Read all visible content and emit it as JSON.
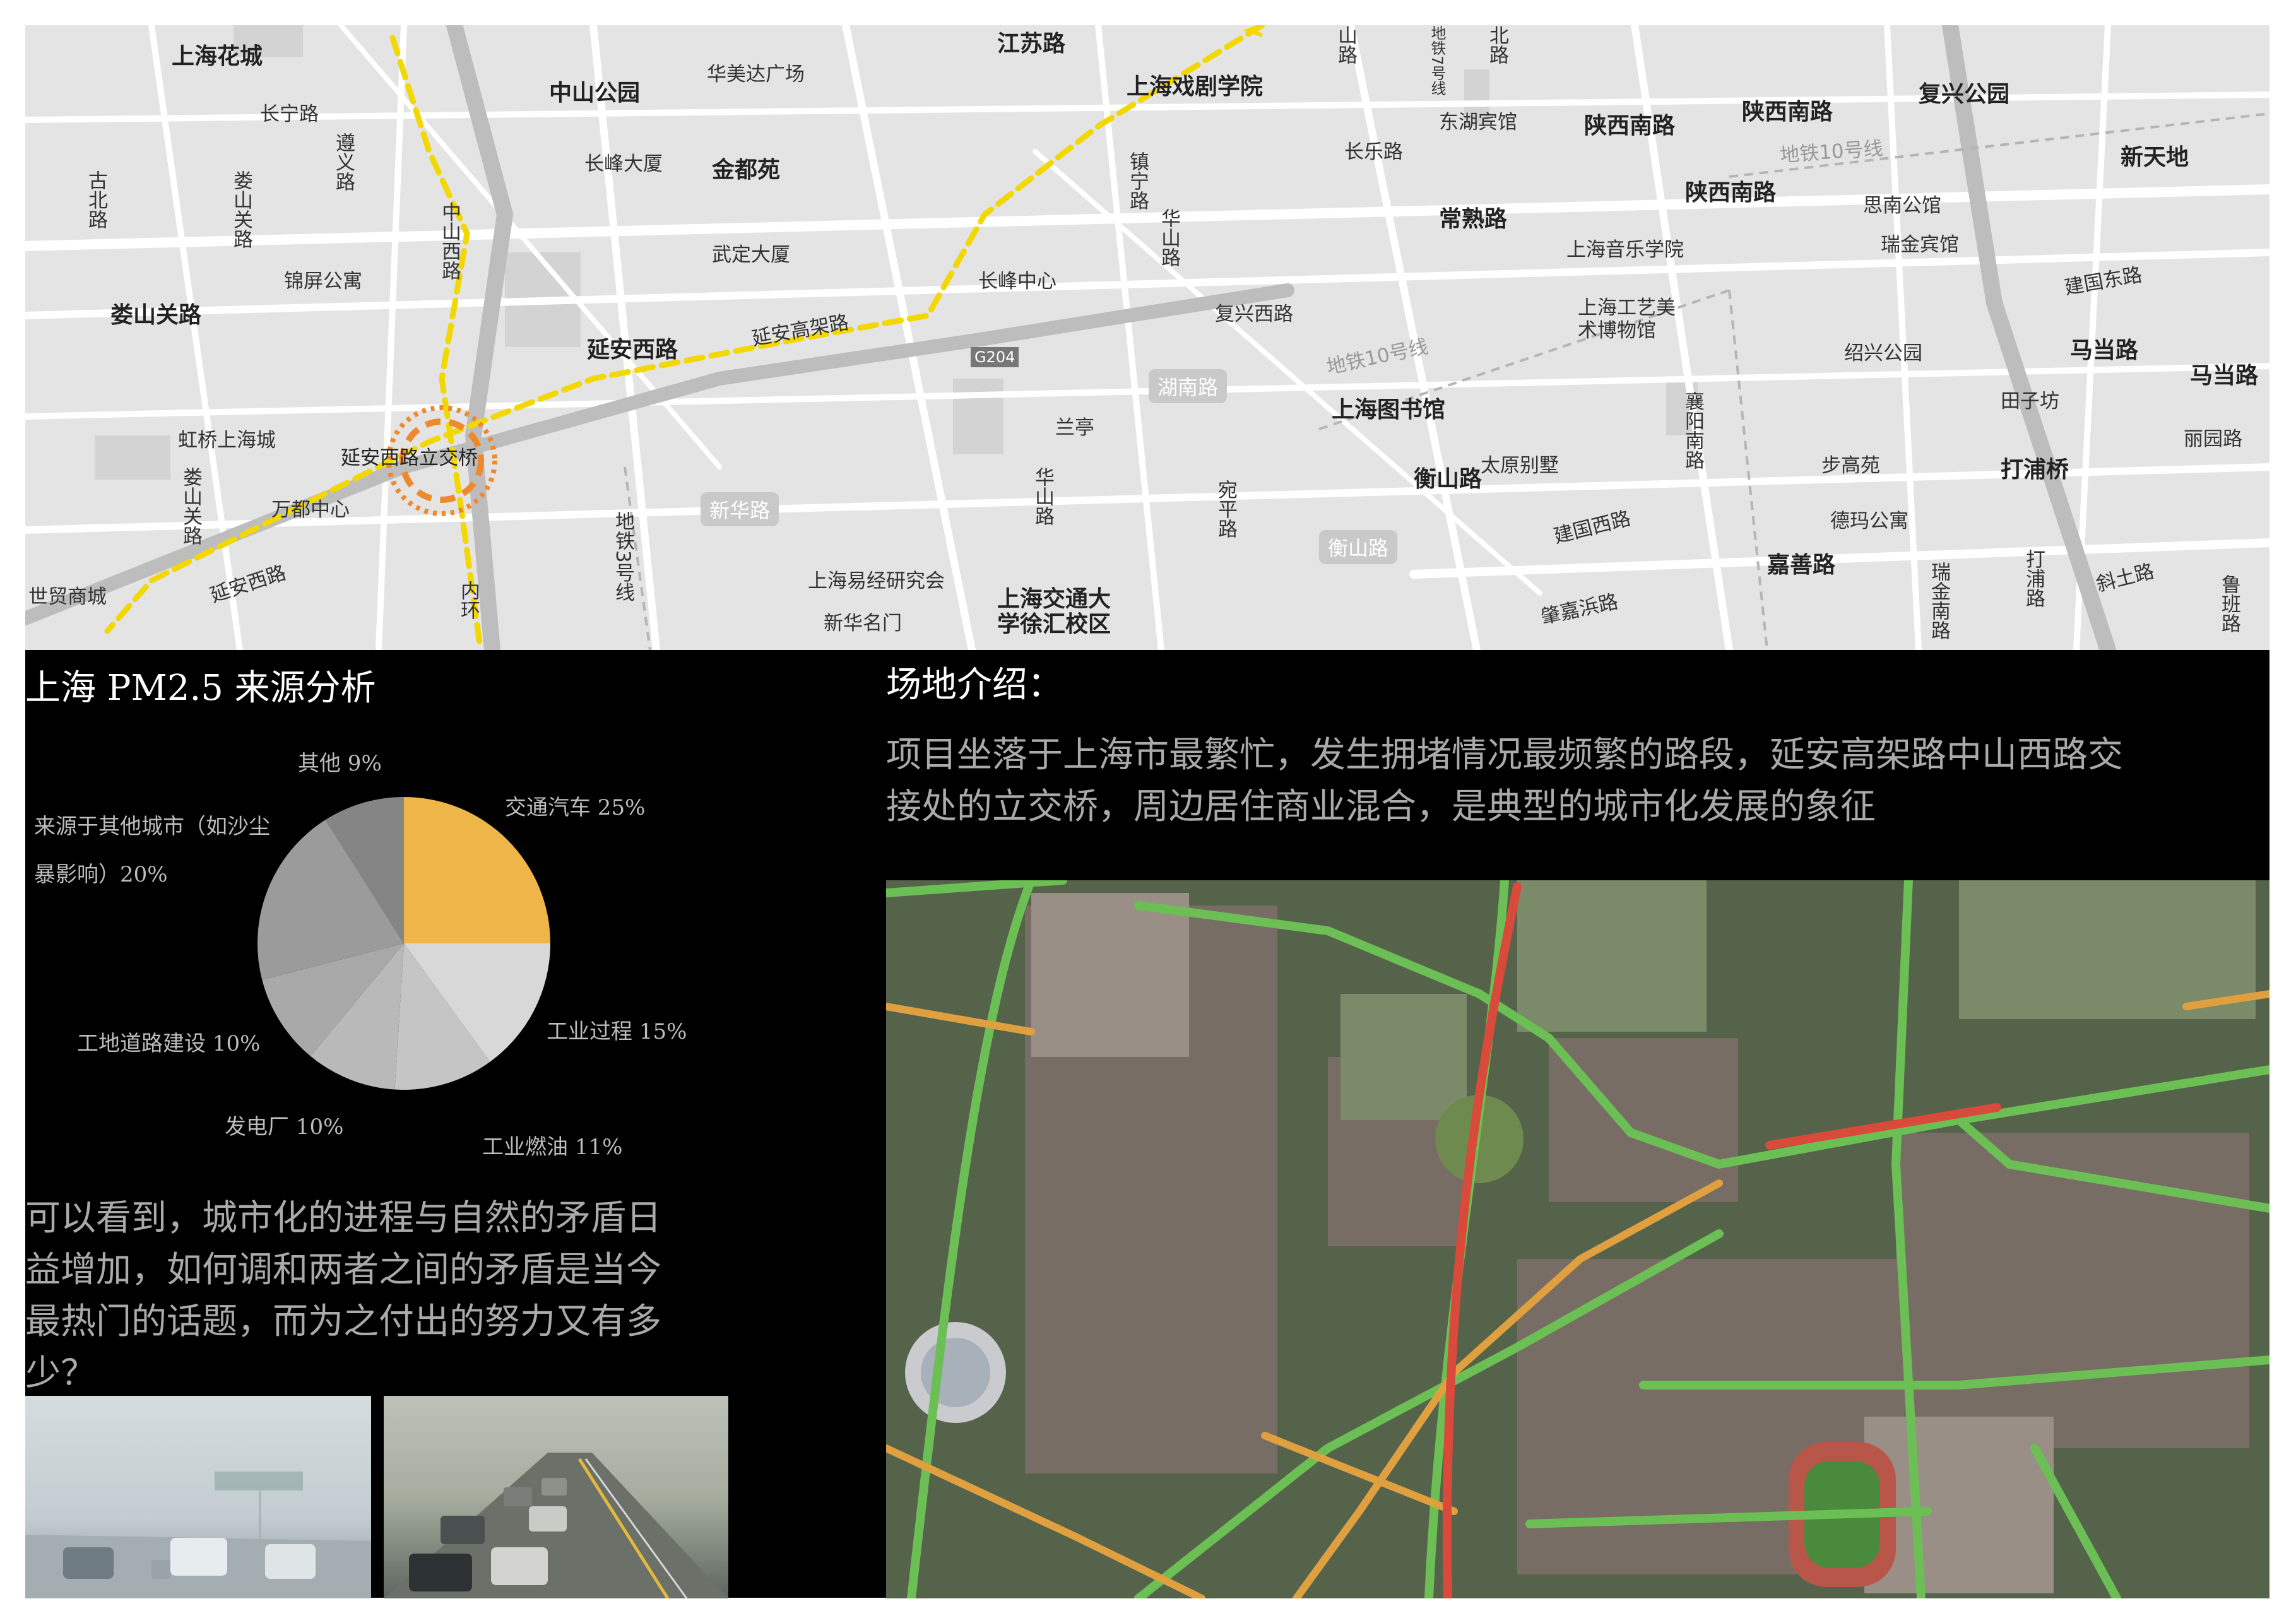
{
  "map": {
    "labels": [
      {
        "text": "上海花城"
      },
      {
        "text": "中山公园"
      },
      {
        "text": "华美达广场"
      },
      {
        "text": "江苏路"
      },
      {
        "text": "上海戏剧学院"
      },
      {
        "text": "长宁路"
      },
      {
        "text": "长峰大厦"
      },
      {
        "text": "金都苑"
      },
      {
        "text": "古北路"
      },
      {
        "text": "娄山关路"
      },
      {
        "text": "遵义路"
      },
      {
        "text": "中山西路"
      },
      {
        "text": "武定大厦"
      },
      {
        "text": "锦屏公寓"
      },
      {
        "text": "长峰中心"
      },
      {
        "text": "镇宁路"
      },
      {
        "text": "娄山关路"
      },
      {
        "text": "延安西路"
      },
      {
        "text": "延安高架路"
      },
      {
        "text": "G204"
      },
      {
        "text": "湖南路"
      },
      {
        "text": "华山路"
      },
      {
        "text": "复兴西路"
      },
      {
        "text": "虹桥上海城"
      },
      {
        "text": "延安西路立交桥"
      },
      {
        "text": "兰亭"
      },
      {
        "text": "娄山关路"
      },
      {
        "text": "万都中心"
      },
      {
        "text": "新华路"
      },
      {
        "text": "华山路"
      },
      {
        "text": "地铁3号线"
      },
      {
        "text": "世贸商城"
      },
      {
        "text": "延安西路"
      },
      {
        "text": "上海易经研究会"
      },
      {
        "text": "新华名门"
      },
      {
        "text": "上海交通大学徐汇校区"
      },
      {
        "text": "内环"
      },
      {
        "text": "东湖宾馆"
      },
      {
        "text": "长乐路"
      },
      {
        "text": "陕西南路"
      },
      {
        "text": "陕西南路"
      },
      {
        "text": "复兴公园"
      },
      {
        "text": "陕西南路"
      },
      {
        "text": "地铁10号线"
      },
      {
        "text": "新天地"
      },
      {
        "text": "常熟路"
      },
      {
        "text": "上海音乐学院"
      },
      {
        "text": "思南公馆"
      },
      {
        "text": "瑞金宾馆"
      },
      {
        "text": "地铁10号线"
      },
      {
        "text": "上海工艺美术博物馆"
      },
      {
        "text": "建国东路"
      },
      {
        "text": "绍兴公园"
      },
      {
        "text": "马当路"
      },
      {
        "text": "马当路"
      },
      {
        "text": "上海图书馆"
      },
      {
        "text": "田子坊"
      },
      {
        "text": "襄阳南路"
      },
      {
        "text": "太原别墅"
      },
      {
        "text": "步高苑"
      },
      {
        "text": "丽园路"
      },
      {
        "text": "打浦桥"
      },
      {
        "text": "衡山路"
      },
      {
        "text": "宛平路"
      },
      {
        "text": "衡山路"
      },
      {
        "text": "建国西路"
      },
      {
        "text": "德玛公寓"
      },
      {
        "text": "嘉善路"
      },
      {
        "text": "肇嘉浜路"
      },
      {
        "text": "瑞金南路"
      },
      {
        "text": "打浦路"
      },
      {
        "text": "斜土路"
      },
      {
        "text": "鲁班路"
      },
      {
        "text": "山路"
      },
      {
        "text": "地铁7号线"
      },
      {
        "text": "北路"
      }
    ]
  },
  "pm25": {
    "title": "上海 PM2.5 来源分析",
    "labels": {
      "traffic": "交通汽车 25%",
      "industry_process": "工业过程 15%",
      "industry_oil": "工业燃油 11%",
      "power": "发电厂 10%",
      "construction": "工地道路建设 10%",
      "other_city_line1": "来源于其他城市（如沙尘",
      "other_city_line2": "暴影响）20%",
      "other": "其他 9%"
    }
  },
  "chart_data": {
    "type": "pie",
    "title": "上海 PM2.5 来源分析",
    "categories": [
      "交通汽车",
      "工业过程",
      "工业燃油",
      "发电厂",
      "工地道路建设",
      "来源于其他城市（如沙尘暴影响）",
      "其他"
    ],
    "values": [
      25,
      15,
      11,
      10,
      10,
      20,
      9
    ],
    "colors": [
      "#eeb648",
      "#d8d8d8",
      "#c5c5c5",
      "#b9b9b9",
      "#a9a9a9",
      "#9b9b9b",
      "#858585"
    ],
    "legend": "labels beside slices"
  },
  "conclusion": {
    "line1": "可以看到，城市化的进程与自然的矛盾日",
    "line2": "益增加，如何调和两者之间的矛盾是当今",
    "line3": "最热门的话题，而为之付出的努力又有多",
    "line4": "少？"
  },
  "site": {
    "title": "场地介绍：",
    "line1": "项目坐落于上海市最繁忙，发生拥堵情况最频繁的路段，延安高架路中山西路交",
    "line2": "接处的立交桥，周边居住商业混合，是典型的城市化发展的象征"
  }
}
